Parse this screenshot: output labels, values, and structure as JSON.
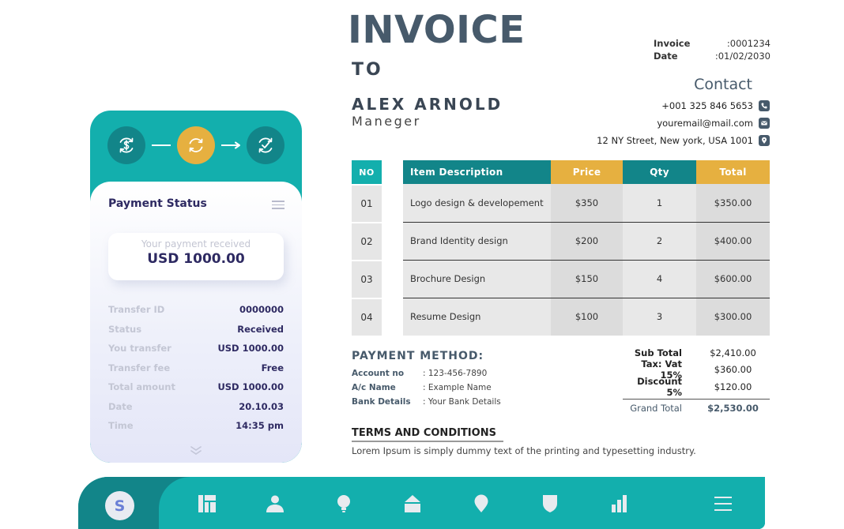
{
  "invoice": {
    "title": "INVOICE",
    "to_label": "TO",
    "client_name": "ALEX ARNOLD",
    "client_role": "Maneger",
    "meta": [
      {
        "label": "Invoice",
        "value": ":0001234"
      },
      {
        "label": "Date",
        "value": ":01/02/2030"
      }
    ]
  },
  "contact": {
    "title": "Contact",
    "items": [
      {
        "text": "+001 325 846 5653",
        "icon": "phone-icon"
      },
      {
        "text": "youremail@mail.com",
        "icon": "mail-icon"
      },
      {
        "text": "12 NY Street, New york, USA 1001",
        "icon": "location-icon"
      }
    ]
  },
  "table": {
    "headers": {
      "no": "NO",
      "desc": "Item Description",
      "price": "Price",
      "qty": "Qty",
      "total": "Total"
    },
    "rows": [
      {
        "no": "01",
        "desc": "Logo design & developement",
        "price": "$350",
        "qty": "1",
        "total": "$350.00"
      },
      {
        "no": "02",
        "desc": "Brand Identity design",
        "price": "$200",
        "qty": "2",
        "total": "$400.00"
      },
      {
        "no": "03",
        "desc": "Brochure Design",
        "price": "$150",
        "qty": "4",
        "total": "$600.00"
      },
      {
        "no": "04",
        "desc": "Resume Design",
        "price": "$100",
        "qty": "3",
        "total": "$300.00"
      }
    ],
    "colors": {
      "teal": "#13afad",
      "dark_teal": "#128589",
      "gold": "#e6b040"
    }
  },
  "payment_method": {
    "title": "PAYMENT METHOD:",
    "rows": [
      {
        "label": "Account no",
        "value": ": 123-456-7890"
      },
      {
        "label": "A/c Name",
        "value": ": Example Name"
      },
      {
        "label": "Bank Details",
        "value": ": Your Bank Details"
      }
    ]
  },
  "totals": {
    "rows": [
      {
        "label": "Sub Total",
        "value": "$2,410.00"
      },
      {
        "label": "Tax: Vat 15%",
        "value": "$360.00"
      },
      {
        "label": "Discount 5%",
        "value": "$120.00"
      }
    ],
    "grand": {
      "label": "Grand Total",
      "value": "$2,530.00"
    }
  },
  "terms": {
    "title": "TERMS AND CONDITIONS",
    "text": "Lorem Ipsum is simply dummy text of the printing and typesetting industry."
  },
  "payment_card": {
    "steps": [
      {
        "icon": "dollar-exchange-icon",
        "state": "done"
      },
      {
        "icon": "refresh-icon",
        "state": "active"
      },
      {
        "icon": "check-refresh-icon",
        "state": "pending"
      }
    ],
    "title": "Payment Status",
    "received_label": "Your payment received",
    "received_amount": "USD 1000.00",
    "details": [
      {
        "label": "Transfer ID",
        "value": "0000000"
      },
      {
        "label": "Status",
        "value": "Received"
      },
      {
        "label": "You transfer",
        "value": "USD 1000.00"
      },
      {
        "label": "Transfer fee",
        "value": "Free"
      },
      {
        "label": "Total amount",
        "value": "USD 1000.00"
      },
      {
        "label": "Date",
        "value": "20.10.03"
      },
      {
        "label": "Time",
        "value": "14:35 pm"
      }
    ]
  },
  "nav": {
    "avatar_letter": "S",
    "items": [
      "dashboard-icon",
      "user-icon",
      "bulb-icon",
      "home-icon",
      "location-pin-icon",
      "shield-icon",
      "bar-chart-icon",
      "menu-icon"
    ]
  }
}
